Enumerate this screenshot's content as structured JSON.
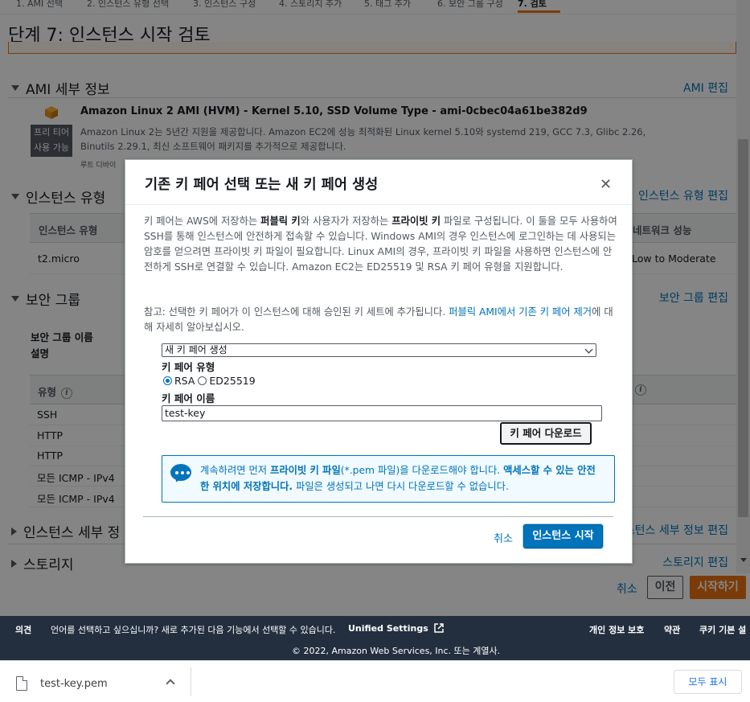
{
  "wizard": {
    "steps": [
      "1. AMI 선택",
      "2. 인스턴스 유형 선택",
      "3. 인스턴스 구성",
      "4. 스토리지 추가",
      "5. 태그 추가",
      "6. 보안 그룹 구성",
      "7. 검토"
    ],
    "active_step": "7. 검토",
    "page_title": "단계 7: 인스턴스 시작 검토"
  },
  "ami_section": {
    "title": "AMI 세부 정보",
    "edit_link": "AMI 편집",
    "icon": "cube-icon",
    "free_tier_line1": "프리 티어",
    "free_tier_line2": "사용 가능",
    "ami_name": "Amazon Linux 2 AMI (HVM) - Kernel 5.10, SSD Volume Type - ami-0cbec04a61be382d9",
    "description": "Amazon Linux 2는 5년간 지원을 제공합니다. Amazon EC2에 성능 최적화된 Linux kernel 5.10와 systemd 219, GCC 7.3, Glibc 2.26, Binutils 2.29.1, 최신 소프트웨어 패키지를 추가적으로 제공합니다.",
    "root_device": "루트 디바이"
  },
  "instance_type_section": {
    "title": "인스턴스 유형",
    "edit_link": "인스턴스 유형 편집",
    "col_type": "인스턴스 유형",
    "col_network": "네트워크 성능",
    "row_type": "t2.micro",
    "row_network": "Low to Moderate"
  },
  "security_section": {
    "title": "보안 그룹",
    "edit_link": "보안 그룹 편집",
    "name_label": "보안 그룹 이름",
    "desc_label": "설명",
    "col_type": "유형",
    "rows": [
      "SSH",
      "HTTP",
      "HTTP",
      "모든 ICMP - IPv4",
      "모든 ICMP - IPv4"
    ]
  },
  "instance_detail_section": {
    "title": "인스턴스 세부 정",
    "edit_link": "인스턴스 세부 정보 편집"
  },
  "storage_section": {
    "title": "스토리지",
    "edit_link": "스토리지 편집"
  },
  "bottom_actions": {
    "cancel": "취소",
    "previous": "이전",
    "launch": "시작하기"
  },
  "modal": {
    "title": "기존 키 페어 선택 또는 새 키 페어 생성",
    "close_icon": "close-icon",
    "body_p1_a": "키 페어는 AWS에 저장하는 ",
    "body_p1_b": "퍼블릭 키",
    "body_p1_c": "와 사용자가 저장하는 ",
    "body_p1_d": "프라이빗 키",
    "body_p1_e": " 파일로 구성됩니다. 이 둘을 모두 사용하여 SSH를 통해 인스턴스에 안전하게 접속할 수 있습니다. Windows AMI의 경우 인스턴스에 로그인하는 데 사용되는 암호를 얻으려면 프라이빗 키 파일이 필요합니다. Linux AMI의 경우, 프라이빗 키 파일을 사용하면 인스턴스에 안전하게 SSH로 연결할 수 있습니다. Amazon EC2는 ED25519 및 RSA 키 페어 유형을 지원합니다.",
    "note_a": "참고: 선택한 키 페어가 이 인스턴스에 대해 승인된 키 세트에 추가됩니다. ",
    "note_link": "퍼블릭 AMI에서 기존 키 페어 제거",
    "note_b": "에 대해 자세히 알아보십시오.",
    "select_value": "새 키 페어 생성",
    "key_type_label": "키 페어 유형",
    "radio_rsa": "RSA",
    "radio_ed": "ED25519",
    "selected_type": "RSA",
    "key_name_label": "키 페어 이름",
    "key_name_value": "test-key",
    "download_button": "키 페어 다운로드",
    "alert_icon": "chat-bubble-icon",
    "alert_a": "계속하려면 먼저 ",
    "alert_b": "프라이빗 키 파일",
    "alert_c": "(*.pem 파일)을 다운로드해야 합니다. ",
    "alert_d": "액세스할 수 있는 안전한 위치에 저장합니다.",
    "alert_e": " 파일은 생성되고 나면 다시 다운로드할 수 없습니다.",
    "cancel": "취소",
    "launch": "인스턴스 시작"
  },
  "footer": {
    "feedback": "의견",
    "language_msg": "언어를 선택하고 싶으십니까? 새로 추가된 다음 기능에서 선택할 수 있습니다.",
    "unified_settings": "Unified Settings",
    "external_icon": "external-link-icon",
    "privacy": "개인 정보 보호",
    "terms": "약관",
    "cookies": "쿠키 기본 설",
    "copyright": "© 2022, Amazon Web Services, Inc. 또는 계열사."
  },
  "download_bar": {
    "file_icon": "file-icon",
    "file_name": "test-key.pem",
    "show_all": "모두 표시"
  },
  "colors": {
    "accent_orange": "#ec7211",
    "link_blue": "#0073bb",
    "footer_bg": "#232f3e"
  }
}
